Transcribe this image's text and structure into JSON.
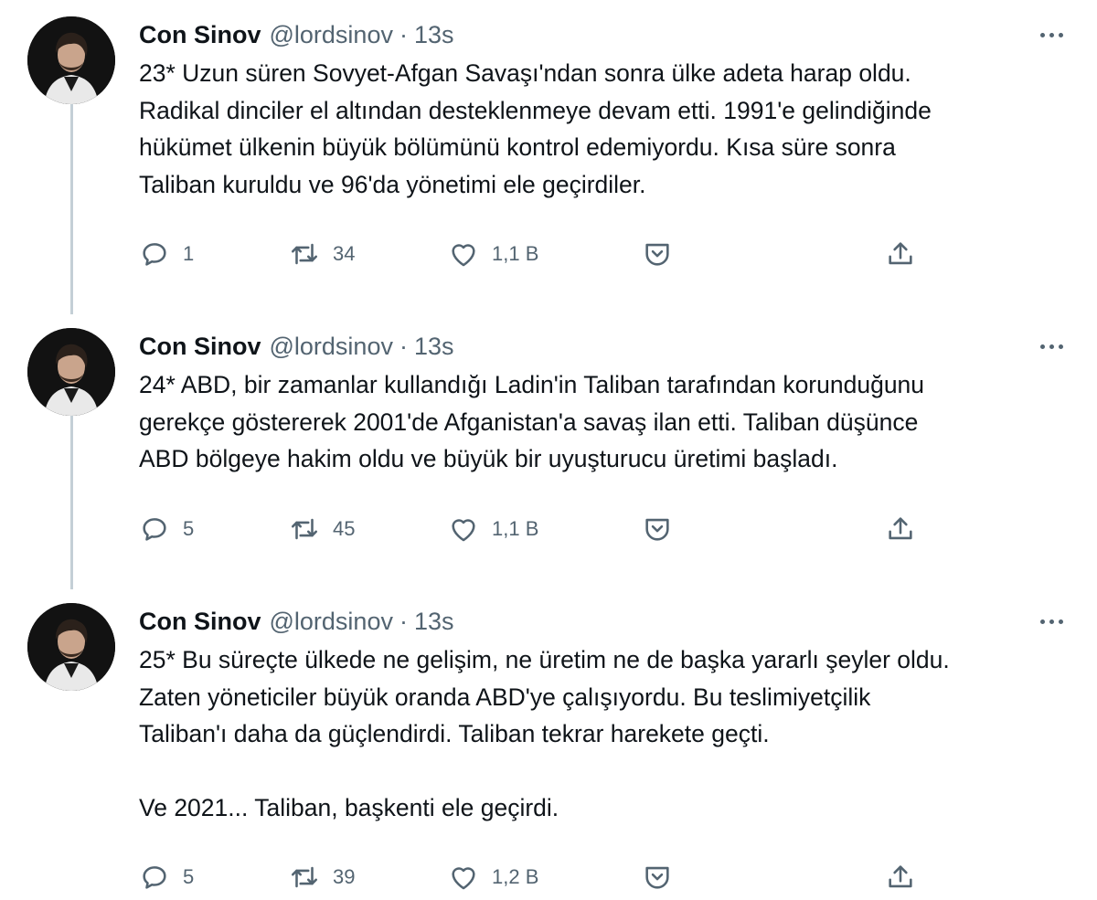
{
  "tweets": [
    {
      "name": "Con Sinov",
      "handle": "@lordsinov",
      "separator": "·",
      "time": "13s",
      "text": "23* Uzun süren Sovyet-Afgan Savaşı'ndan sonra ülke adeta harap oldu. Radikal dinciler el altından desteklenmeye devam etti. 1991'e gelindiğinde hükümet ülkenin büyük bölümünü kontrol edemiyordu. Kısa süre sonra Taliban kuruldu ve 96'da yönetimi ele geçirdiler.",
      "text_lines": [
        "23* Uzun süren Sovyet-Afgan Savaşı'ndan sonra ülke adeta harap oldu.",
        "Radikal dinciler el altından desteklenmeye devam etti. 1991'e gelindiğinde",
        "hükümet ülkenin büyük bölümünü kontrol edemiyordu. Kısa süre sonra",
        "Taliban kuruldu ve 96'da yönetimi ele geçirdiler."
      ],
      "replies": "1",
      "retweets": "34",
      "likes": "1,1 B"
    },
    {
      "name": "Con Sinov",
      "handle": "@lordsinov",
      "separator": "·",
      "time": "13s",
      "text_lines": [
        "24* ABD, bir zamanlar kullandığı Ladin'in Taliban tarafından korunduğunu",
        "gerekçe göstererek 2001'de Afganistan'a savaş ilan etti. Taliban düşünce",
        "ABD bölgeye hakim oldu ve büyük bir uyuşturucu üretimi başladı."
      ],
      "replies": "5",
      "retweets": "45",
      "likes": "1,1 B"
    },
    {
      "name": "Con Sinov",
      "handle": "@lordsinov",
      "separator": "·",
      "time": "13s",
      "text_lines": [
        "25* Bu süreçte ülkede ne gelişim, ne üretim ne de başka yararlı şeyler oldu.",
        "Zaten yöneticiler büyük oranda ABD'ye çalışıyordu. Bu teslimiyetçilik",
        "Taliban'ı daha da güçlendirdi. Taliban tekrar harekete geçti.",
        "",
        "Ve 2021... Taliban, başkenti ele geçirdi."
      ],
      "replies": "5",
      "retweets": "39",
      "likes": "1,2 B"
    }
  ],
  "colors": {
    "text": "#0f1419",
    "secondary": "#536471",
    "thread_line": "#c4cfd6"
  },
  "icons": [
    "reply-icon",
    "retweet-icon",
    "like-icon",
    "tip-icon",
    "share-icon",
    "more-icon"
  ]
}
